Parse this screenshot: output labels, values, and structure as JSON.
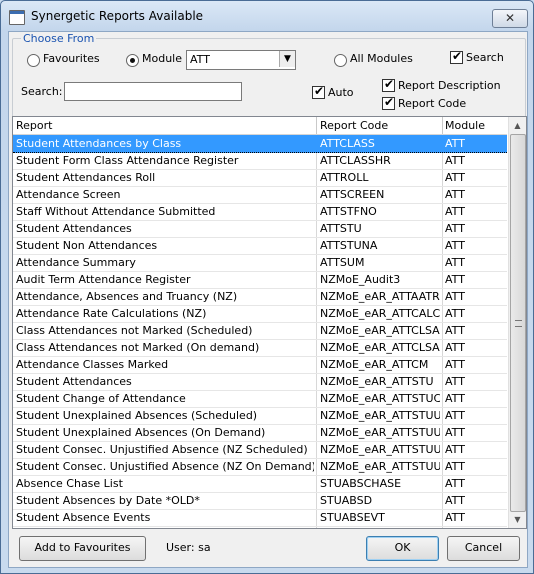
{
  "window": {
    "title": "Synergetic Reports Available",
    "close_glyph": "✕"
  },
  "choose_from": {
    "legend": "Choose From",
    "favourites_label": "Favourites",
    "module_label": "Module",
    "module_value": "ATT",
    "all_modules_label": "All Modules",
    "search_toggle_label": "Search",
    "search_label": "Search:",
    "search_value": "",
    "auto_label": "Auto",
    "report_description_label": "Report Description",
    "report_code_label": "Report Code",
    "selected_radio": "module",
    "search_checked": true,
    "auto_checked": true,
    "report_description_checked": true,
    "report_code_checked": true
  },
  "grid": {
    "columns": [
      "Report",
      "Report Code",
      "Module"
    ],
    "selected_index": 0,
    "rows": [
      [
        "Student Attendances by Class",
        "ATTCLASS",
        "ATT"
      ],
      [
        "Student Form Class Attendance Register",
        "ATTCLASSHR",
        "ATT"
      ],
      [
        "Student Attendances Roll",
        "ATTROLL",
        "ATT"
      ],
      [
        "Attendance Screen",
        "ATTSCREEN",
        "ATT"
      ],
      [
        "Staff Without Attendance Submitted",
        "ATTSTFNO",
        "ATT"
      ],
      [
        "Student Attendances",
        "ATTSTU",
        "ATT"
      ],
      [
        "Student Non Attendances",
        "ATTSTUNA",
        "ATT"
      ],
      [
        "Attendance Summary",
        "ATTSUM",
        "ATT"
      ],
      [
        "Audit Term Attendance Register",
        "NZMoE_Audit3",
        "ATT"
      ],
      [
        "Attendance, Absences and Truancy (NZ)",
        "NZMoE_eAR_ATTAATR",
        "ATT"
      ],
      [
        "Attendance Rate Calculations (NZ)",
        "NZMoE_eAR_ATTCALC",
        "ATT"
      ],
      [
        "Class Attendances not Marked (Scheduled)",
        "NZMoE_eAR_ATTCLSAM",
        "ATT"
      ],
      [
        "Class Attendances not Marked (On demand)",
        "NZMoE_eAR_ATTCLSAMD",
        "ATT"
      ],
      [
        "Attendance Classes Marked",
        "NZMoE_eAR_ATTCM",
        "ATT"
      ],
      [
        "Student Attendances",
        "NZMoE_eAR_ATTSTU",
        "ATT"
      ],
      [
        "Student Change of Attendance",
        "NZMoE_eAR_ATTSTUCHG",
        "ATT"
      ],
      [
        "Student Unexplained Absences (Scheduled)",
        "NZMoE_eAR_ATTSTUUNE",
        "ATT"
      ],
      [
        "Student Unexplained Absences (On Demand)",
        "NZMoE_eAR_ATTSTUUNE",
        "ATT"
      ],
      [
        "Student Consec. Unjustified Absence (NZ Scheduled)",
        "NZMoE_eAR_ATTSTUUNJ",
        "ATT"
      ],
      [
        "Student Consec. Unjustified Absence (NZ On Demand)",
        "NZMoE_eAR_ATTSTUUNJ",
        "ATT"
      ],
      [
        "Absence Chase List",
        "STUABSCHASE",
        "ATT"
      ],
      [
        "Student Absences by Date *OLD*",
        "STUABSD",
        "ATT"
      ],
      [
        "Student Absence Events",
        "STUABSEVT",
        "ATT"
      ]
    ]
  },
  "footer": {
    "add_to_favourites_label": "Add to Favourites",
    "user_label": "User: sa",
    "ok_label": "OK",
    "cancel_label": "Cancel"
  },
  "colors": {
    "selection": "#3399ff",
    "legend_text": "#1a53b0",
    "window_frame": "#c9dbef"
  },
  "icons": {
    "scroll_up": "scroll-up-icon",
    "scroll_down": "scroll-down-icon",
    "dropdown": "chevron-down-icon"
  }
}
